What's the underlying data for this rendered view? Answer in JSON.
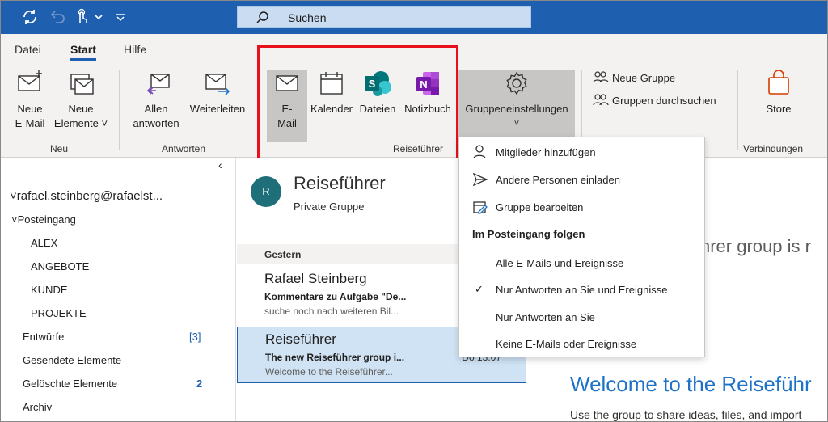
{
  "search": {
    "label": "Suchen"
  },
  "menu": {
    "tabs": [
      "Datei",
      "Start",
      "Hilfe"
    ]
  },
  "ribbon": {
    "new_email": [
      "Neue",
      "E-Mail"
    ],
    "new_items": [
      "Neue",
      "Elemente"
    ],
    "reply_all": [
      "Allen",
      "antworten"
    ],
    "forward": "Weiterleiten",
    "mail": [
      "E-",
      "Mail"
    ],
    "calendar": "Kalender",
    "files": "Dateien",
    "notebook": "Notizbuch",
    "group_settings": "Gruppeneinstellungen",
    "new_group": "Neue Gruppe",
    "browse_groups": "Gruppen durchsuchen",
    "store": "Store",
    "groups": {
      "new": "Neu",
      "respond": "Antworten",
      "guide": "Reiseführer",
      "connections": "Verbindungen"
    }
  },
  "folders": {
    "account": "rafael.steinberg@rafaelst...",
    "inbox": "Posteingang",
    "subfolders": [
      "ALEX",
      "ANGEBOTE",
      "KUNDE",
      "PROJEKTE"
    ],
    "drafts": "Entwürfe",
    "drafts_count": "[3]",
    "sent": "Gesendete Elemente",
    "deleted": "Gelöschte Elemente",
    "deleted_count": "2",
    "archive": "Archiv"
  },
  "group_header": {
    "avatar_letter": "R",
    "title": "Reiseführer",
    "subtitle": "Private Gruppe"
  },
  "messages": {
    "date_header": "Gestern",
    "items": [
      {
        "from": "Rafael Steinberg",
        "subject": "Kommentare zu Aufgabe \"De...",
        "preview": "suche noch nach weiteren Bil..."
      },
      {
        "from": "Reiseführer",
        "subject": "The new Reiseführer group i...",
        "preview": "Welcome to the Reiseführer...",
        "date": "Do 13:07"
      }
    ]
  },
  "reading_pane": {
    "partial_title": "hrer group is r",
    "welcome": "Welcome to the Reiseführ",
    "body": "Use the group to share ideas, files, and import"
  },
  "dropdown": {
    "add_members": "Mitglieder hinzufügen",
    "invite_others": "Andere Personen einladen",
    "edit_group": "Gruppe bearbeiten",
    "follow_header": "Im Posteingang folgen",
    "follow_options": [
      "Alle E-Mails und Ereignisse",
      "Nur Antworten an Sie und Ereignisse",
      "Nur Antworten an Sie",
      "Keine E-Mails oder Ereignisse"
    ],
    "checked_symbol": "✓"
  },
  "colors": {
    "title_bar": "#1e5fb0",
    "accent": "#1e73c8",
    "highlight_box": "#e8101a"
  }
}
